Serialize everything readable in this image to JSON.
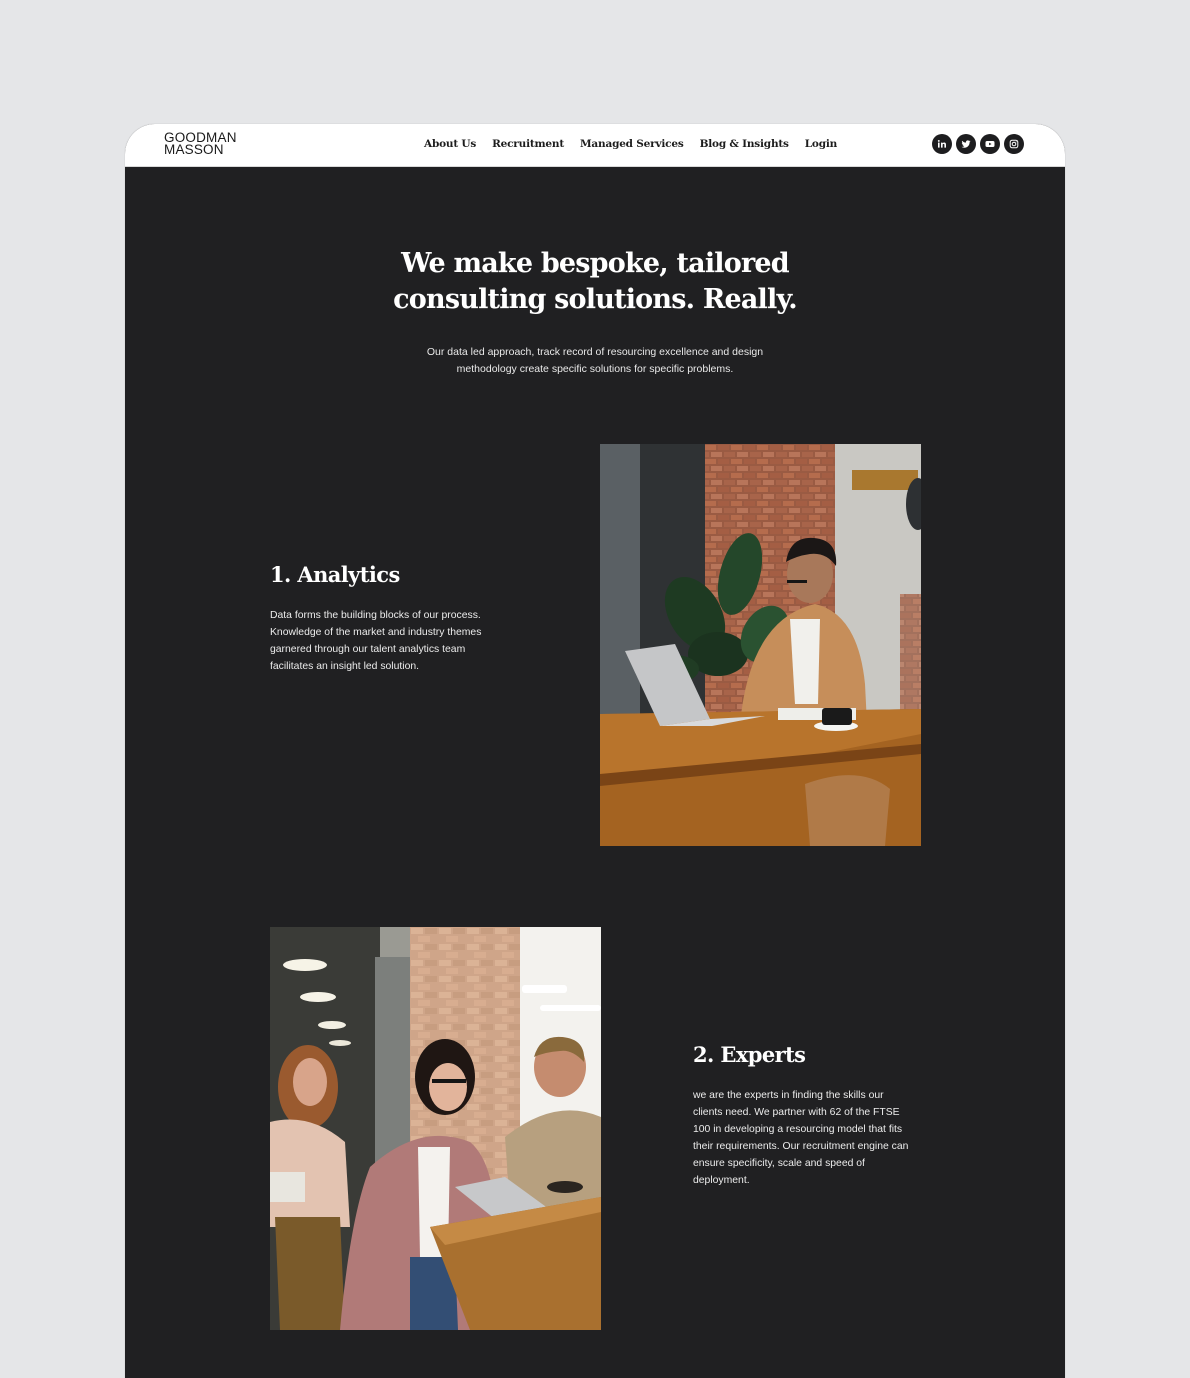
{
  "brand": {
    "line1": "GOODMAN",
    "line2": "MASSON"
  },
  "nav": [
    {
      "label": "About Us"
    },
    {
      "label": "Recruitment"
    },
    {
      "label": "Managed Services"
    },
    {
      "label": "Blog & Insights"
    },
    {
      "label": "Login"
    }
  ],
  "socials": [
    "linkedin-icon",
    "twitter-icon",
    "youtube-icon",
    "instagram-icon"
  ],
  "hero": {
    "title_line1": "We make bespoke,  tailored",
    "title_line2": "consulting solutions. Really.",
    "subtitle_line1": "Our data led approach, track record of resourcing excellence and design",
    "subtitle_line2": "methodology create specific solutions for specific problems."
  },
  "sections": [
    {
      "heading": "1. Analytics",
      "body_lines": [
        "Data forms the building blocks of our process.",
        "Knowledge of the market and industry themes",
        "garnered through our talent analytics team",
        "facilitates an insight led solution."
      ]
    },
    {
      "heading": "2. Experts",
      "body_lines": [
        "we are the experts in finding the skills our",
        "clients need. We partner with 62 of the FTSE",
        "100 in developing a resourcing model that fits",
        "their requirements. Our recruitment engine can",
        "ensure specificity, scale and speed of",
        "deployment."
      ]
    }
  ],
  "colors": {
    "page_bg": "#e5e6e8",
    "dark_bg": "#202022",
    "nav_bg": "#ffffff",
    "text_light": "#ffffff"
  }
}
